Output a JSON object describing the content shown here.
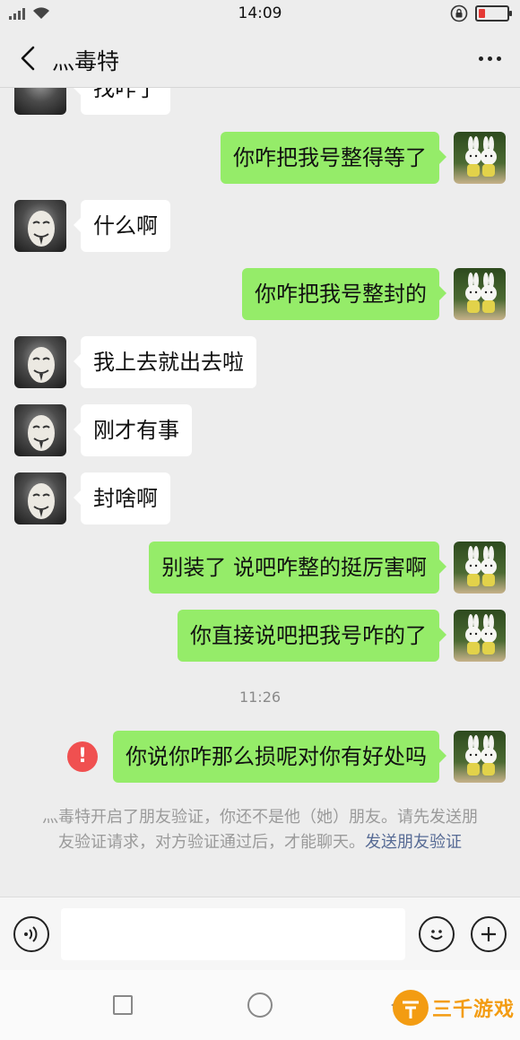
{
  "status_bar": {
    "time": "14:09"
  },
  "header": {
    "title": "灬毒特",
    "back_icon": "chevron-left-icon",
    "more_icon": "more-dots-icon"
  },
  "messages": [
    {
      "side": "left",
      "text": "找咋了"
    },
    {
      "side": "right",
      "text": "你咋把我号整得等了"
    },
    {
      "side": "left",
      "text": "什么啊"
    },
    {
      "side": "right",
      "text": "你咋把我号整封的"
    },
    {
      "side": "left",
      "text": "我上去就出去啦"
    },
    {
      "side": "left",
      "text": "刚才有事"
    },
    {
      "side": "left",
      "text": "封啥啊"
    },
    {
      "side": "right",
      "text": "别装了  说吧咋整的挺厉害啊"
    },
    {
      "side": "right",
      "text": "你直接说吧把我号咋的了"
    },
    {
      "side": "right",
      "text": "你说你咋那么损呢对你有好处吗",
      "failed": true
    }
  ],
  "timestamp": "11:26",
  "error_mark": "!",
  "system_note": {
    "text": "灬毒特开启了朋友验证，你还不是他（她）朋友。请先发送朋友验证请求，对方验证通过后，才能聊天。",
    "link": "发送朋友验证"
  },
  "input_bar": {
    "value": "",
    "voice_icon": "voice-icon",
    "emoji_icon": "emoji-icon",
    "plus_icon": "plus-icon"
  },
  "watermark": {
    "text": "三千游戏"
  },
  "colors": {
    "bubble_green": "#95ec69",
    "bubble_white": "#ffffff",
    "error_red": "#f05050",
    "link_blue": "#576b95",
    "battery_red": "#e53935",
    "watermark_orange": "#f39c12"
  }
}
